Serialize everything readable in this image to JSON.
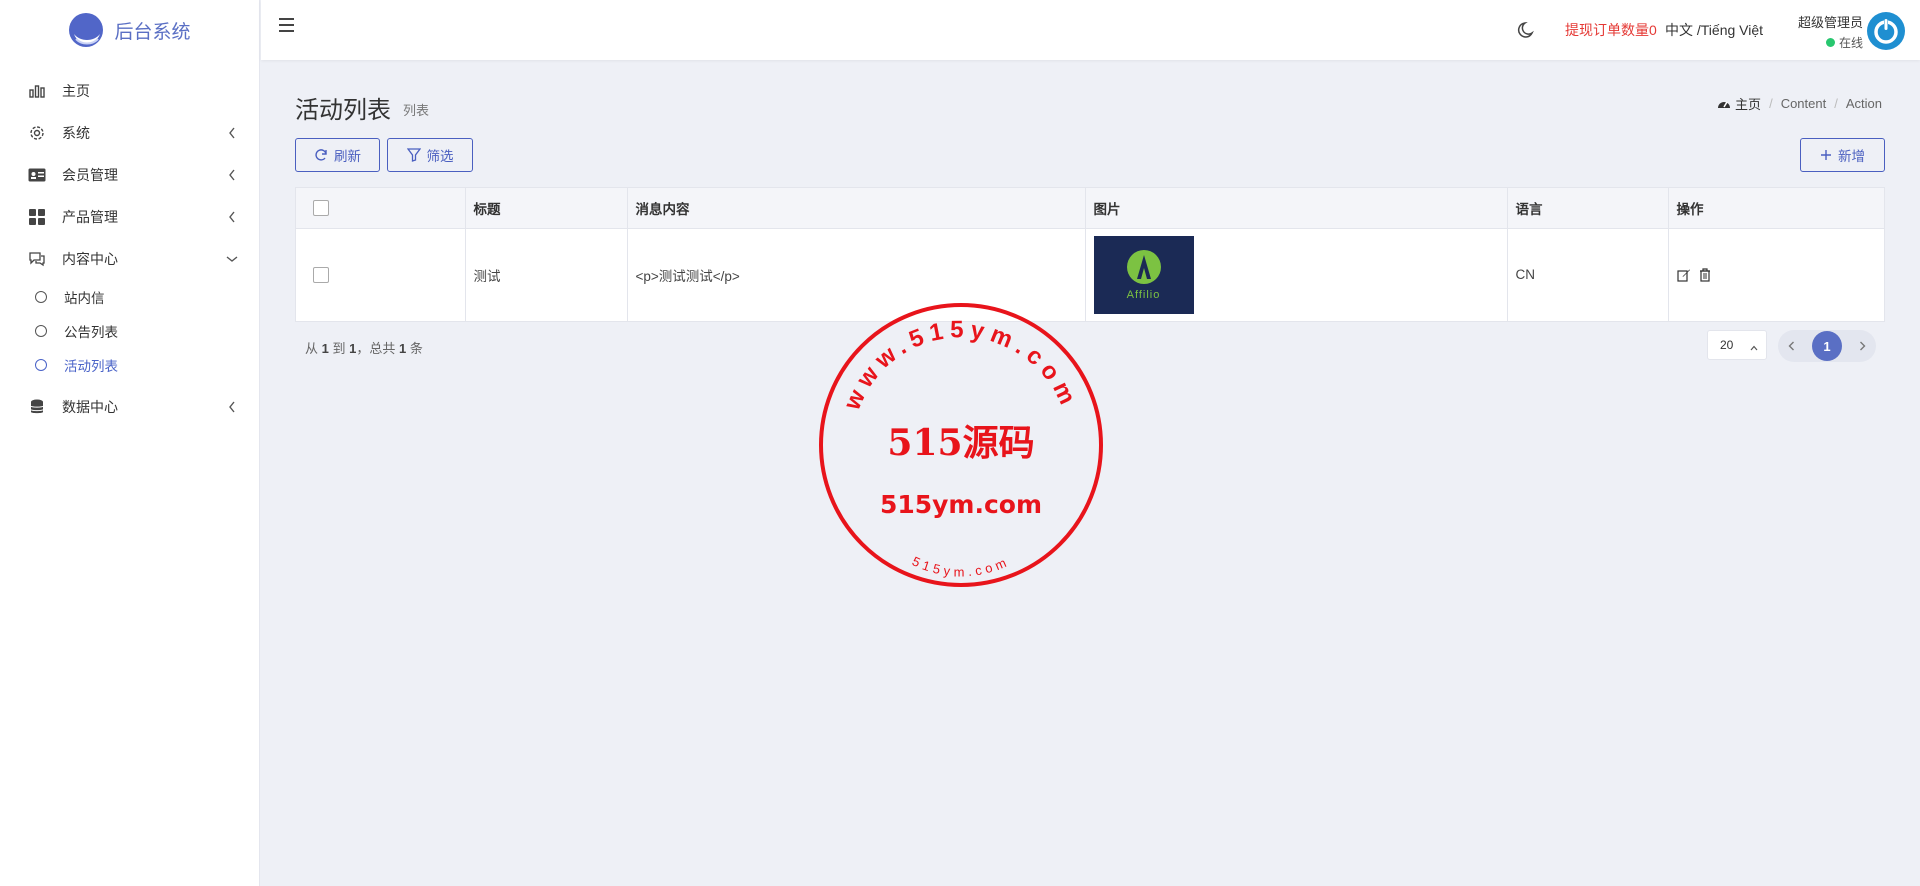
{
  "brand": {
    "name": "后台系统"
  },
  "sidebar": {
    "items": [
      {
        "label": "主页",
        "icon": "bar-chart-icon",
        "has_children": false
      },
      {
        "label": "系统",
        "icon": "gear-icon",
        "has_children": true
      },
      {
        "label": "会员管理",
        "icon": "id-card-icon",
        "has_children": true
      },
      {
        "label": "产品管理",
        "icon": "grid-icon",
        "has_children": true
      },
      {
        "label": "内容中心",
        "icon": "chat-icon",
        "has_children": true,
        "expanded": true
      },
      {
        "label": "数据中心",
        "icon": "database-icon",
        "has_children": true
      }
    ],
    "content_sub": [
      {
        "label": "站内信",
        "active": false
      },
      {
        "label": "公告列表",
        "active": false
      },
      {
        "label": "活动列表",
        "active": true
      }
    ]
  },
  "header": {
    "withdraw_label": "提现订单数量0",
    "language": "中文 /Tiếng Việt",
    "user_name": "超级管理员",
    "user_status": "在线"
  },
  "page": {
    "title": "活动列表",
    "subtitle": "列表",
    "breadcrumb": [
      "主页",
      "Content",
      "Action"
    ]
  },
  "toolbar": {
    "refresh_label": "刷新",
    "filter_label": "筛选",
    "add_label": "新增"
  },
  "table": {
    "columns": [
      "标题",
      "消息内容",
      "图片",
      "语言",
      "操作"
    ],
    "rows": [
      {
        "title": "测试",
        "content": "<p>测试测试</p>",
        "image_text": "Affilio",
        "language": "CN"
      }
    ]
  },
  "footer": {
    "summary_prefix": "从",
    "summary_from": "1",
    "summary_to_word": "到",
    "summary_to": "1",
    "summary_total_word": "，总共",
    "summary_total": "1",
    "summary_unit": "条",
    "page_size": "20",
    "current_page": "1"
  },
  "watermark": {
    "outer_text": "www.515ym.com",
    "center_text": "515源码",
    "url_text": "515ym.com",
    "bottom_text": "515ym.com",
    "color": "#e8141b"
  },
  "colors": {
    "accent": "#4a5fc0",
    "alert": "#e53935",
    "online": "#28c76f"
  }
}
